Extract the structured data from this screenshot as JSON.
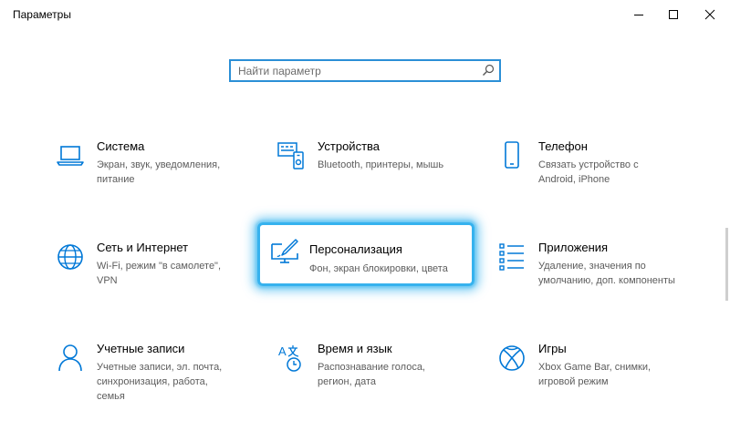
{
  "window": {
    "title": "Параметры"
  },
  "search": {
    "placeholder": "Найти параметр"
  },
  "accent_color": "#0078d7",
  "highlight_color": "#36b2ee",
  "tiles": [
    {
      "name": "Система",
      "desc": "Экран, звук, уведомления, питание",
      "icon": "laptop-icon"
    },
    {
      "name": "Устройства",
      "desc": "Bluetooth, принтеры, мышь",
      "icon": "devices-icon"
    },
    {
      "name": "Телефон",
      "desc": "Связать устройство с Android, iPhone",
      "icon": "phone-icon"
    },
    {
      "name": "Сеть и Интернет",
      "desc": "Wi-Fi, режим \"в самолете\", VPN",
      "icon": "globe-icon"
    },
    {
      "name": "Персонализация",
      "desc": "Фон, экран блокировки, цвета",
      "icon": "personalization-icon"
    },
    {
      "name": "Приложения",
      "desc": "Удаление, значения по умолчанию, доп. компоненты",
      "icon": "apps-icon"
    },
    {
      "name": "Учетные записи",
      "desc": "Учетные записи, эл. почта, синхронизация, работа, семья",
      "icon": "person-icon"
    },
    {
      "name": "Время и язык",
      "desc": "Распознавание голоса, регион, дата",
      "icon": "time-language-icon"
    },
    {
      "name": "Игры",
      "desc": "Xbox Game Bar, снимки, игровой режим",
      "icon": "xbox-icon"
    }
  ]
}
